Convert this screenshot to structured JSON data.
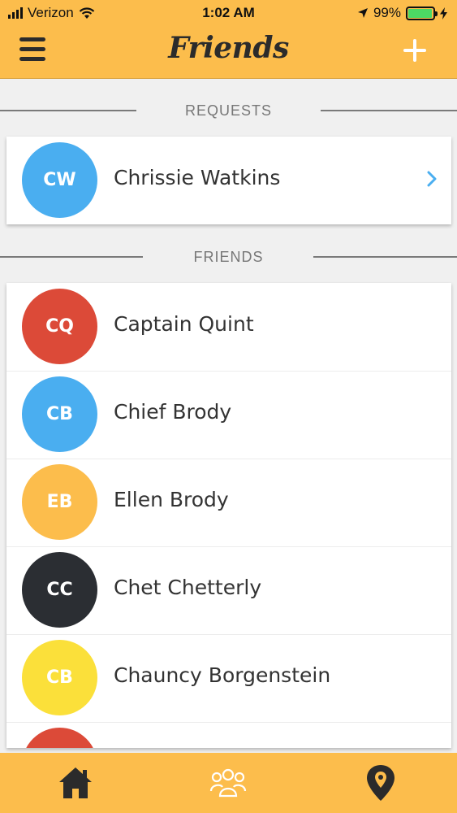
{
  "status": {
    "carrier": "Verizon",
    "time": "1:02 AM",
    "battery": "99%",
    "battery_level": 0.99
  },
  "header": {
    "title": "Friends",
    "menu_icon": "hamburger-menu-icon",
    "add_icon": "plus-icon"
  },
  "requests": {
    "label": "REQUESTS",
    "items": [
      {
        "initials": "CW",
        "name": "Chrissie Watkins",
        "color": "#4aaef0"
      }
    ]
  },
  "friends": {
    "label": "FRIENDS",
    "items": [
      {
        "initials": "CQ",
        "name": "Captain Quint",
        "color": "#dc4a38"
      },
      {
        "initials": "CB",
        "name": "Chief Brody",
        "color": "#4aaef0"
      },
      {
        "initials": "EB",
        "name": "Ellen Brody",
        "color": "#fcbd4c"
      },
      {
        "initials": "CC",
        "name": "Chet Chetterly",
        "color": "#2b2e33"
      },
      {
        "initials": "CB",
        "name": "Chauncy Borgenstein",
        "color": "#fbe03a"
      },
      {
        "initials": "",
        "name": "",
        "color": "#dc4a38"
      }
    ]
  },
  "tabbar": {
    "items": [
      {
        "icon": "home-icon"
      },
      {
        "icon": "group-icon"
      },
      {
        "icon": "map-pin-icon"
      }
    ]
  },
  "colors": {
    "brand": "#fcbd4c",
    "accent_chevron": "#4aaef0"
  }
}
